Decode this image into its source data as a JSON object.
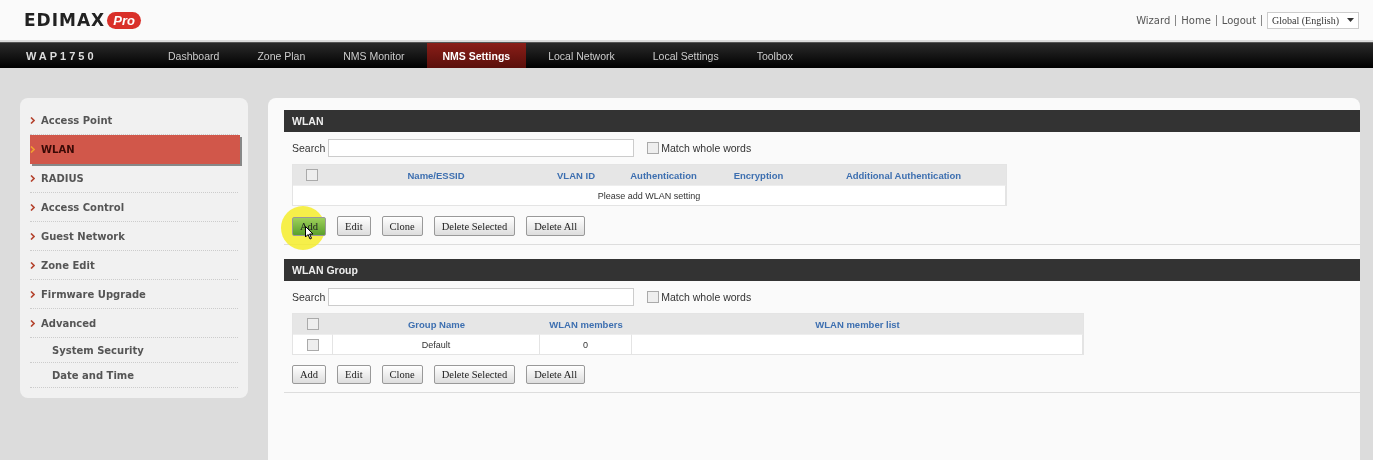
{
  "header": {
    "logo": {
      "brand": "EDIMAX",
      "badge": "Pro"
    },
    "links": [
      "Wizard",
      "Home",
      "Logout"
    ],
    "language": "Global (English)"
  },
  "nav": {
    "model": "WAP1750",
    "items": [
      {
        "label": "Dashboard",
        "selected": false
      },
      {
        "label": "Zone Plan",
        "selected": false
      },
      {
        "label": "NMS Monitor",
        "selected": false
      },
      {
        "label": "NMS Settings",
        "selected": true
      },
      {
        "label": "Local Network",
        "selected": false
      },
      {
        "label": "Local Settings",
        "selected": false
      },
      {
        "label": "Toolbox",
        "selected": false
      }
    ]
  },
  "sidebar": {
    "items": [
      {
        "label": "Access Point",
        "selected": false
      },
      {
        "label": "WLAN",
        "selected": true
      },
      {
        "label": "RADIUS",
        "selected": false
      },
      {
        "label": "Access Control",
        "selected": false
      },
      {
        "label": "Guest Network",
        "selected": false
      },
      {
        "label": "Zone Edit",
        "selected": false
      },
      {
        "label": "Firmware Upgrade",
        "selected": false
      },
      {
        "label": "Advanced",
        "selected": false,
        "children": [
          {
            "label": "System Security",
            "selected": false
          },
          {
            "label": "Date and Time",
            "selected": false
          }
        ]
      }
    ]
  },
  "sections": [
    {
      "title": "WLAN",
      "search_label": "Search",
      "match_label": "Match whole words",
      "match_checked": false,
      "columns": [
        "Name/ESSID",
        "VLAN ID",
        "Authentication",
        "Encryption",
        "Additional Authentication"
      ],
      "select_all_checked": false,
      "empty_text": "Please add WLAN setting",
      "buttons": [
        {
          "label": "Add",
          "highlighted": true
        },
        {
          "label": "Edit",
          "highlighted": false
        },
        {
          "label": "Clone",
          "highlighted": false
        },
        {
          "label": "Delete Selected",
          "highlighted": false
        },
        {
          "label": "Delete All",
          "highlighted": false
        }
      ]
    },
    {
      "title": "WLAN Group",
      "search_label": "Search",
      "match_label": "Match whole words",
      "match_checked": false,
      "columns": [
        "Group Name",
        "WLAN members",
        "WLAN member list"
      ],
      "select_all_checked": false,
      "rows": [
        {
          "checked": false,
          "cells": [
            "Default",
            "0"
          ]
        }
      ],
      "buttons": [
        {
          "label": "Add",
          "highlighted": false
        },
        {
          "label": "Edit",
          "highlighted": false
        },
        {
          "label": "Clone",
          "highlighted": false
        },
        {
          "label": "Delete Selected",
          "highlighted": false
        },
        {
          "label": "Delete All",
          "highlighted": false
        }
      ]
    }
  ]
}
